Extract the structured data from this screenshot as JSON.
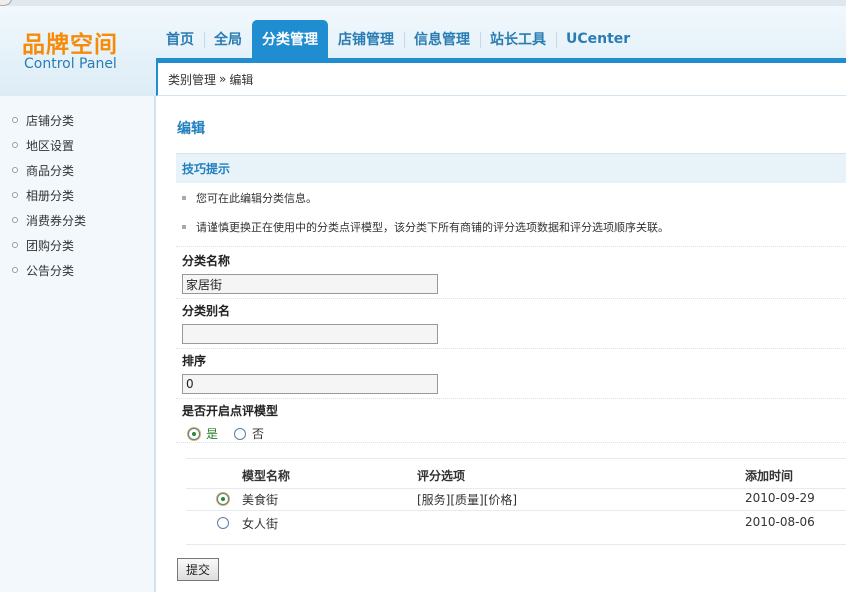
{
  "logo": {
    "title": "品牌空间",
    "subtitle": "Control Panel"
  },
  "nav": {
    "items": [
      {
        "label": "首页"
      },
      {
        "label": "全局"
      },
      {
        "label": "分类管理"
      },
      {
        "label": "店铺管理"
      },
      {
        "label": "信息管理"
      },
      {
        "label": "站长工具"
      },
      {
        "label": "UCenter"
      }
    ],
    "active_index": 2
  },
  "breadcrumb": {
    "parent": "类别管理",
    "separator": "»",
    "current": "编辑"
  },
  "sidebar": {
    "items": [
      {
        "label": "店铺分类"
      },
      {
        "label": "地区设置"
      },
      {
        "label": "商品分类"
      },
      {
        "label": "相册分类"
      },
      {
        "label": "消费券分类"
      },
      {
        "label": "团购分类"
      },
      {
        "label": "公告分类"
      }
    ]
  },
  "page": {
    "title": "编辑"
  },
  "tips": {
    "heading": "技巧提示",
    "items": [
      "您可在此编辑分类信息。",
      "请谨慎更换正在使用中的分类点评模型，该分类下所有商铺的评分选项数据和评分选项顺序关联。"
    ]
  },
  "form": {
    "name_label": "分类名称",
    "name_value": "家居街",
    "alias_label": "分类别名",
    "alias_value": "",
    "order_label": "排序",
    "order_value": "0",
    "review_label": "是否开启点评模型",
    "review_yes": "是",
    "review_no": "否",
    "review_selected": "yes"
  },
  "models": {
    "headers": {
      "name": "模型名称",
      "options": "评分选项",
      "date": "添加时间"
    },
    "rows": [
      {
        "name": "美食街",
        "options": "[服务][质量][价格]",
        "date": "2010-09-29",
        "selected": true
      },
      {
        "name": "女人街",
        "options": "",
        "date": "2010-08-06",
        "selected": false
      }
    ]
  },
  "submit_label": "提交"
}
